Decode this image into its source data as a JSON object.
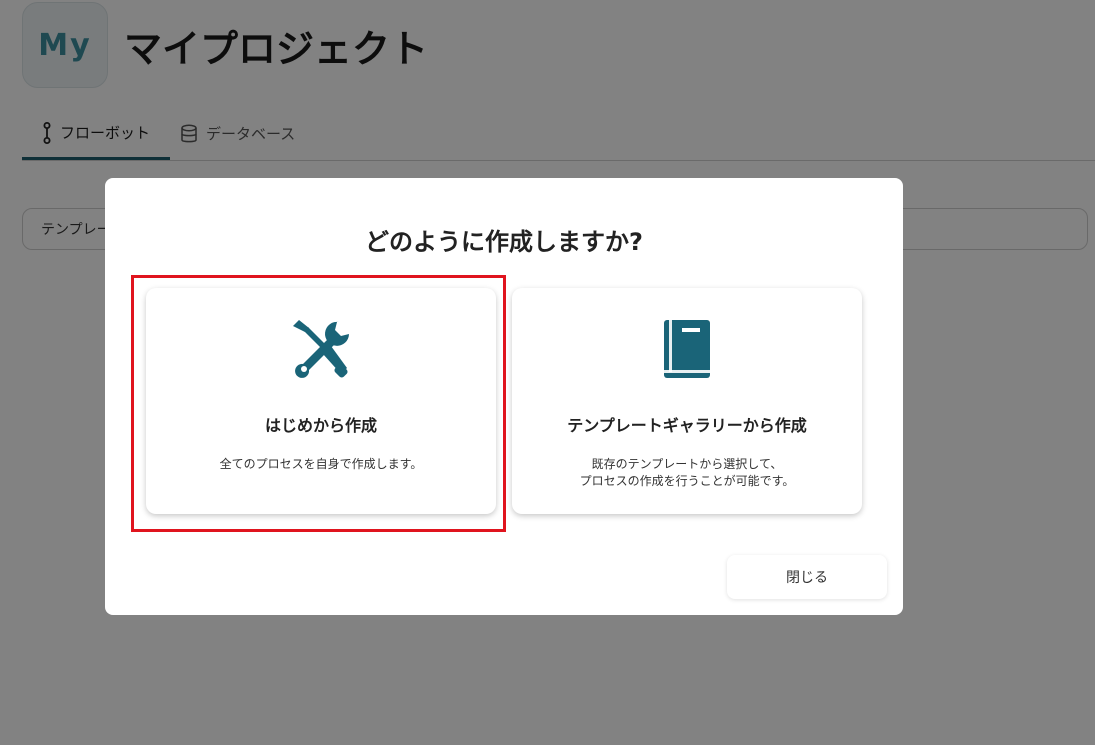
{
  "header": {
    "app_icon_text": "My",
    "title": "マイプロジェクト"
  },
  "tabs": [
    {
      "label": "フローボット",
      "icon": "flow-icon",
      "active": true
    },
    {
      "label": "データベース",
      "icon": "database-icon",
      "active": false
    }
  ],
  "template_bar": {
    "label": "テンプレート"
  },
  "modal": {
    "title": "どのように作成しますか?",
    "options": [
      {
        "label": "はじめから作成",
        "description": "全てのプロセスを自身で作成します。",
        "icon": "tools-icon"
      },
      {
        "label": "テンプレートギャラリーから作成",
        "description_line1": "既存のテンプレートから選択して、",
        "description_line2": "プロセスの作成を行うことが可能です。",
        "icon": "book-icon"
      }
    ],
    "close_label": "閉じる"
  },
  "colors": {
    "accent": "#1a6478",
    "highlight": "#e0141e",
    "overlay": "rgba(0,0,0,0.49)"
  }
}
